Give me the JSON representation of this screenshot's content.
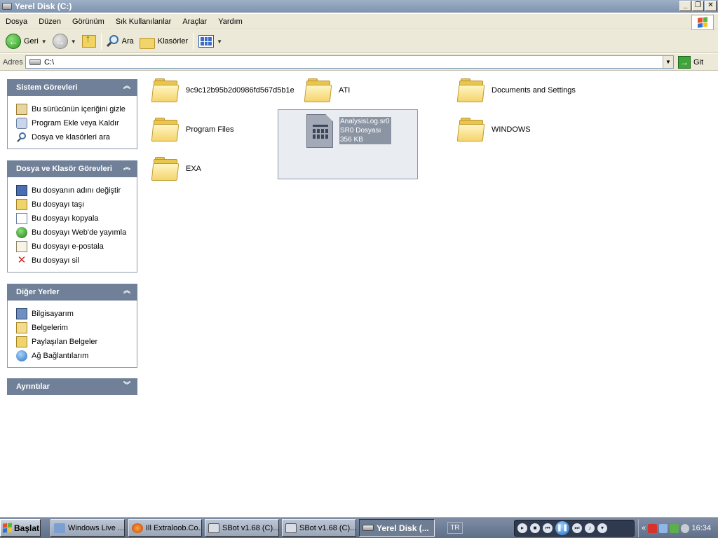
{
  "window": {
    "title": "Yerel Disk (C:)",
    "min": "_",
    "max": "❐",
    "close": "✕"
  },
  "menu": [
    "Dosya",
    "Düzen",
    "Görünüm",
    "Sık Kullanılanlar",
    "Araçlar",
    "Yardım"
  ],
  "toolbar": {
    "back_label": "Geri",
    "search_label": "Ara",
    "folders_label": "Klasörler"
  },
  "address": {
    "label": "Adres",
    "value": "C:\\",
    "go_label": "Git"
  },
  "panes": {
    "system": {
      "title": "Sistem Görevleri",
      "items": [
        "Bu sürücünün içeriğini gizle",
        "Program Ekle veya Kaldır",
        "Dosya ve klasörleri ara"
      ]
    },
    "file": {
      "title": "Dosya ve Klasör Görevleri",
      "items": [
        "Bu dosyanın adını değiştir",
        "Bu dosyayı taşı",
        "Bu dosyayı kopyala",
        "Bu dosyayı Web'de yayımla",
        "Bu dosyayı e-postala",
        "Bu dosyayı sil"
      ]
    },
    "other": {
      "title": "Diğer Yerler",
      "items": [
        "Bilgisayarım",
        "Belgelerim",
        "Paylaşılan Belgeler",
        "Ağ Bağlantılarım"
      ]
    },
    "details": {
      "title": "Ayrıntılar"
    }
  },
  "files": {
    "folders": [
      "9c9c12b95b2d0986fd567d5b1e",
      "ATI",
      "Documents and Settings",
      "Program Files",
      "WINDOWS",
      "EXA"
    ],
    "selected": {
      "name": "AnalysisLog.sr0",
      "type": "SR0 Dosyası",
      "size": "356 KB"
    }
  },
  "taskbar": {
    "start": "Başlat",
    "buttons": [
      "Windows Live ...",
      "Ill Extraloob.Co...",
      "SBot v1.68 (C)...",
      "SBot v1.68 (C)...",
      "Yerel Disk (..."
    ],
    "lang": "TR",
    "tray_collapse": "«",
    "clock": "16:34"
  }
}
